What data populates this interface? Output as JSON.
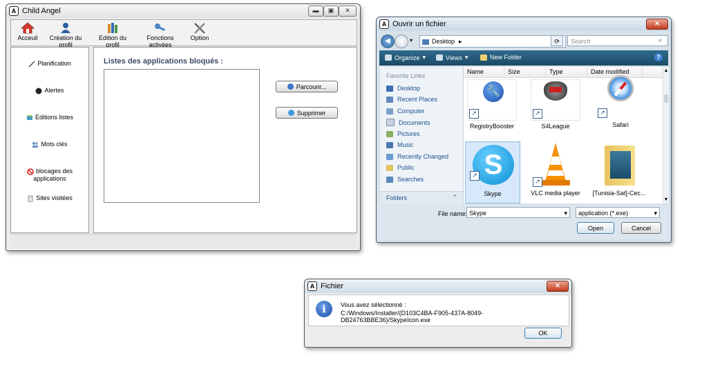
{
  "win_main": {
    "title": "Child Angel",
    "toolbar": [
      {
        "label": "Acceuil",
        "icon": "home-icon"
      },
      {
        "label": "Création du profil",
        "icon": "user-icon"
      },
      {
        "label": "Edition du profil",
        "icon": "books-icon"
      },
      {
        "label": "Fonctions activées",
        "icon": "key-icon"
      },
      {
        "label": "Option",
        "icon": "tools-icon"
      }
    ],
    "sidebar": [
      {
        "label": "Planification",
        "icon": "pen-icon"
      },
      {
        "label": "Alertes",
        "icon": "bomb-icon"
      },
      {
        "label": "Editions listes",
        "icon": "list-icon"
      },
      {
        "label": "Mots clés",
        "icon": "people-icon"
      },
      {
        "label": "blocages des applications",
        "icon": "forbidden-icon"
      },
      {
        "label": "Sites visitées",
        "icon": "document-icon"
      }
    ],
    "main_title": "Listes des applications bloqués :",
    "browse_label": "Parcourir...",
    "delete_label": "Supprimer"
  },
  "win_file": {
    "title": "Ouvrir un fichier",
    "address": "Desktop",
    "search_placeholder": "Search",
    "commands": {
      "organize": "Organize",
      "views": "Views",
      "new_folder": "New Folder"
    },
    "favorite_links_header": "Favorite Links",
    "favorite_links": [
      "Desktop",
      "Recent Places",
      "Computer",
      "Documents",
      "Pictures",
      "Music",
      "Recently Changed",
      "Public",
      "Searches"
    ],
    "folders_label": "Folders",
    "columns": [
      "Name",
      "Size",
      "Type",
      "Date modified"
    ],
    "files": [
      "RegistryBooster",
      "S4League",
      "Safari",
      "Skype",
      "VLC media player",
      "[Tunisia-Sat]-Cec..."
    ],
    "file_name_label": "File name:",
    "file_name_value": "Skype",
    "file_type_value": "application (*.exe)",
    "open_label": "Open",
    "cancel_label": "Cancel"
  },
  "win_msg": {
    "title": "Fichier",
    "line1": "Vous avez sélectionné :",
    "line2": "C:/Windows/Installer/{D103C4BA-F905-437A-8049-DB24763BBE36}/SkypeIcon.exe",
    "ok_label": "OK"
  }
}
